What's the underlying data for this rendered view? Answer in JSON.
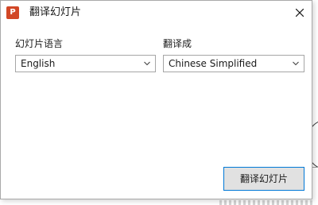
{
  "window": {
    "title": "翻译幻灯片",
    "app_icon_letter": "P",
    "app_icon_name": "powerpoint-icon",
    "close_icon_name": "close-icon"
  },
  "form": {
    "source_label": "幻灯片语言",
    "source_value": "English",
    "target_label": "翻译成",
    "target_value": "Chinese Simplified"
  },
  "actions": {
    "translate_label": "翻译幻灯片"
  },
  "colors": {
    "app_icon": "#d24726",
    "button_focus_border": "#0078d7",
    "button_background": "#e1e1e1"
  }
}
